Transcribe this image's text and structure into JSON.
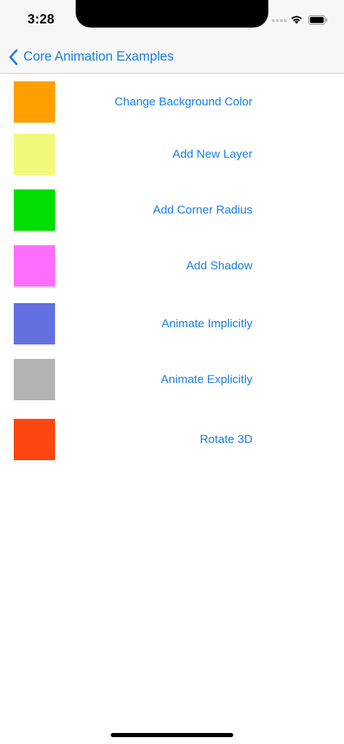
{
  "status_bar": {
    "time": "3:28",
    "icons": [
      "cellular-signal-icon",
      "wifi-icon",
      "battery-icon"
    ]
  },
  "nav": {
    "back_label": "Core Animation Examples",
    "back_icon": "chevron-left-icon"
  },
  "accent_color": "#1a7fe3",
  "rows": [
    {
      "label": "Change Background Color",
      "color": "#ff9f00"
    },
    {
      "label": "Add New Layer",
      "color": "#f2f87a"
    },
    {
      "label": "Add Corner Radius",
      "color": "#00dd00"
    },
    {
      "label": "Add Shadow",
      "color": "#ff6eff"
    },
    {
      "label": "Animate Implicitly",
      "color": "#6470e0"
    },
    {
      "label": "Animate Explicitly",
      "color": "#b3b3b3"
    },
    {
      "label": "Rotate 3D",
      "color": "#ff4610"
    }
  ]
}
